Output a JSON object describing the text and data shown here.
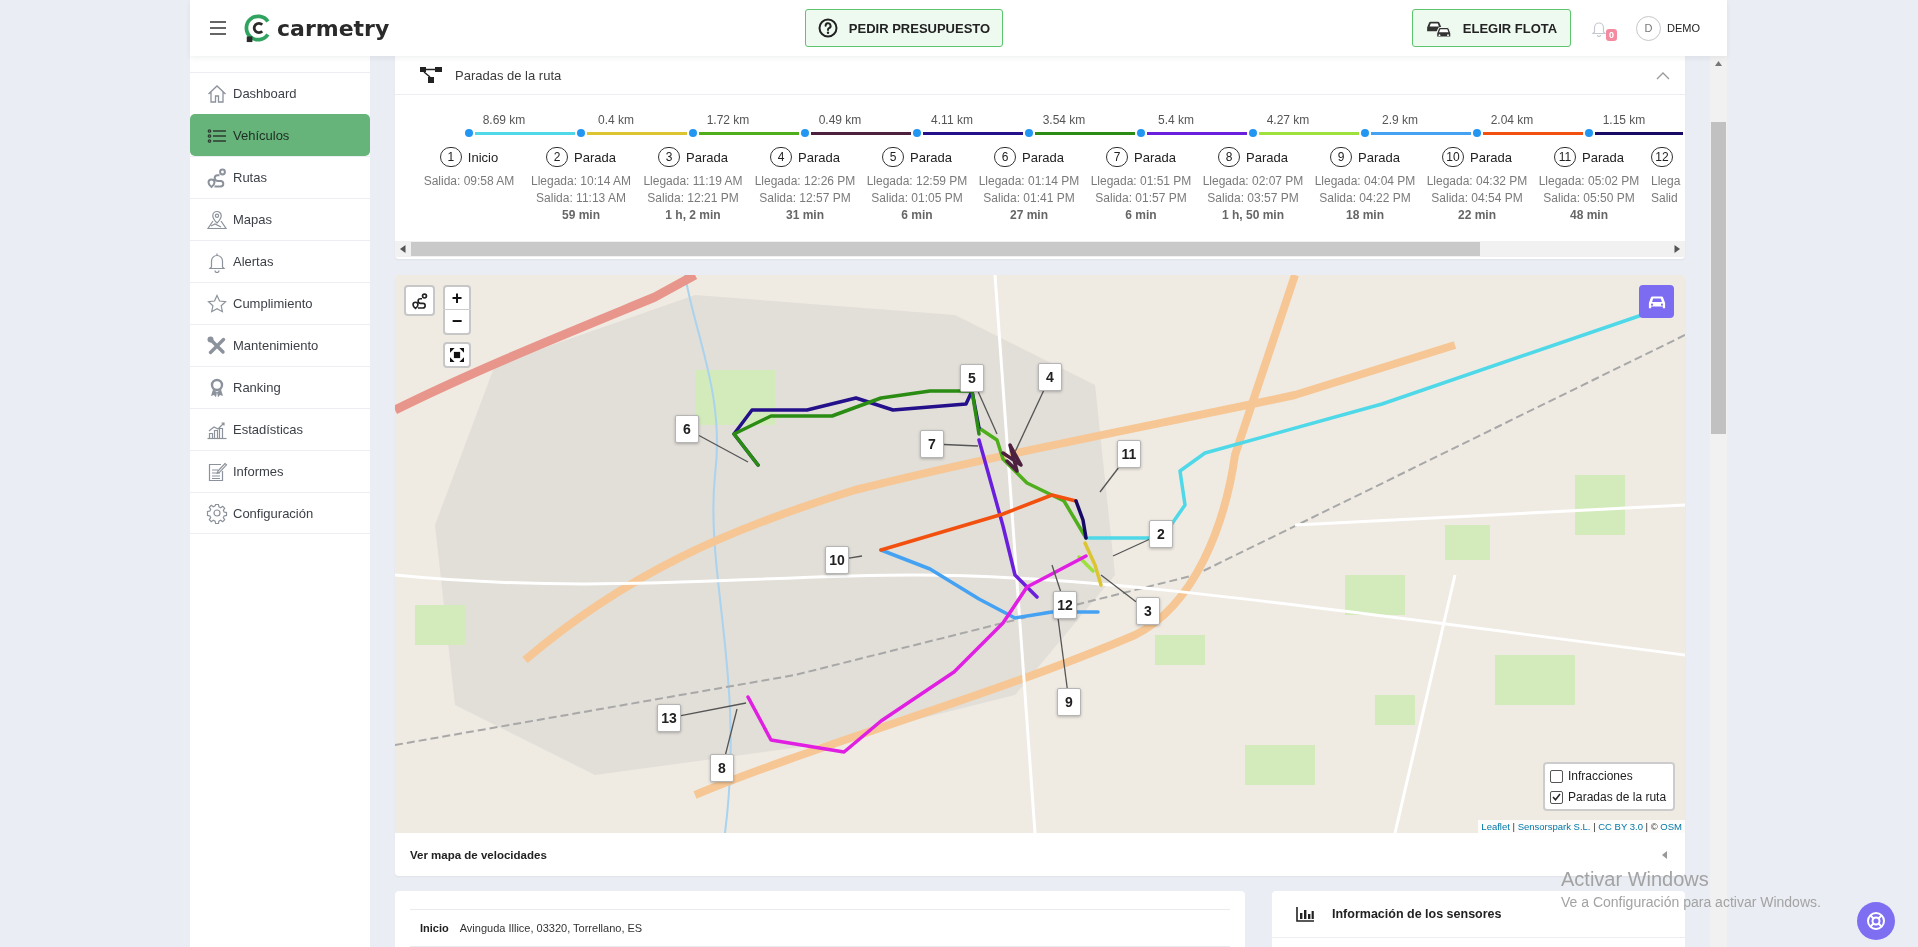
{
  "header": {
    "brand": "carmetry",
    "actions": [
      {
        "label": "PEDIR PRESUPUESTO",
        "kind": "quote"
      },
      {
        "label": "ELEGIR FLOTA",
        "kind": "fleet"
      }
    ],
    "notifications": {
      "count": "0"
    },
    "user": {
      "initial": "D",
      "name": "DEMO"
    }
  },
  "sidebar": {
    "items": [
      {
        "label": "Dashboard",
        "selected": false
      },
      {
        "label": "Vehículos",
        "selected": true
      },
      {
        "label": "Rutas",
        "selected": false
      },
      {
        "label": "Mapas",
        "selected": false
      },
      {
        "label": "Alertas",
        "selected": false
      },
      {
        "label": "Cumplimiento",
        "selected": false
      },
      {
        "label": "Mantenimiento",
        "selected": false
      },
      {
        "label": "Ranking",
        "selected": false
      },
      {
        "label": "Estadísticas",
        "selected": false
      },
      {
        "label": "Informes",
        "selected": false
      },
      {
        "label": "Configuración",
        "selected": false
      }
    ]
  },
  "route_stops": {
    "title": "Paradas de la ruta",
    "expanded": true,
    "segments": [
      {
        "distance": "8.69 km",
        "color": "#4fd8e8"
      },
      {
        "distance": "0.4 km",
        "color": "#dcc531"
      },
      {
        "distance": "1.72 km",
        "color": "#4fae1c"
      },
      {
        "distance": "0.49 km",
        "color": "#4e2040"
      },
      {
        "distance": "4.11 km",
        "color": "#24108a"
      },
      {
        "distance": "3.54 km",
        "color": "#2a8c12"
      },
      {
        "distance": "5.4 km",
        "color": "#6a1fdc"
      },
      {
        "distance": "4.27 km",
        "color": "#9ee03c"
      },
      {
        "distance": "2.9 km",
        "color": "#45a2f2"
      },
      {
        "distance": "2.04 km",
        "color": "#f2500f"
      },
      {
        "distance": "1.15 km",
        "color": "#170a66"
      }
    ],
    "stops": [
      {
        "number": "1",
        "name": "Inicio",
        "departure": "Salida: 09:58 AM"
      },
      {
        "number": "2",
        "name": "Parada",
        "arrival": "Llegada: 10:14 AM",
        "departure": "Salida: 11:13 AM",
        "duration": "59 min"
      },
      {
        "number": "3",
        "name": "Parada",
        "arrival": "Llegada: 11:19 AM",
        "departure": "Salida: 12:21 PM",
        "duration": "1 h, 2 min"
      },
      {
        "number": "4",
        "name": "Parada",
        "arrival": "Llegada: 12:26 PM",
        "departure": "Salida: 12:57 PM",
        "duration": "31 min"
      },
      {
        "number": "5",
        "name": "Parada",
        "arrival": "Llegada: 12:59 PM",
        "departure": "Salida: 01:05 PM",
        "duration": "6 min"
      },
      {
        "number": "6",
        "name": "Parada",
        "arrival": "Llegada: 01:14 PM",
        "departure": "Salida: 01:41 PM",
        "duration": "27 min"
      },
      {
        "number": "7",
        "name": "Parada",
        "arrival": "Llegada: 01:51 PM",
        "departure": "Salida: 01:57 PM",
        "duration": "6 min"
      },
      {
        "number": "8",
        "name": "Parada",
        "arrival": "Llegada: 02:07 PM",
        "departure": "Salida: 03:57 PM",
        "duration": "1 h, 50 min"
      },
      {
        "number": "9",
        "name": "Parada",
        "arrival": "Llegada: 04:04 PM",
        "departure": "Salida: 04:22 PM",
        "duration": "18 min"
      },
      {
        "number": "10",
        "name": "Parada",
        "arrival": "Llegada: 04:32 PM",
        "departure": "Salida: 04:54 PM",
        "duration": "22 min"
      },
      {
        "number": "11",
        "name": "Parada",
        "arrival": "Llegada: 05:02 PM",
        "departure": "Salida: 05:50 PM",
        "duration": "48 min"
      },
      {
        "number": "12",
        "arrival": "Llega",
        "departure": "Salid"
      }
    ]
  },
  "map": {
    "zoom_in": "+",
    "zoom_out": "−",
    "markers": [
      {
        "label": "5"
      },
      {
        "label": "4"
      },
      {
        "label": "6"
      },
      {
        "label": "7"
      },
      {
        "label": "11"
      },
      {
        "label": "2"
      },
      {
        "label": "10"
      },
      {
        "label": "12"
      },
      {
        "label": "3"
      },
      {
        "label": "9"
      },
      {
        "label": "13"
      },
      {
        "label": "8"
      }
    ],
    "legend": [
      {
        "label": "Infracciones",
        "checked": false
      },
      {
        "label": "Paradas de la ruta",
        "checked": true
      }
    ],
    "attribution": [
      {
        "text": "Leaflet",
        "kind": "link"
      },
      {
        "text": "|",
        "kind": "text"
      },
      {
        "text": "Sensorspark S.L.",
        "kind": "link"
      },
      {
        "text": "|",
        "kind": "text"
      },
      {
        "text": "CC BY 3.0",
        "kind": "link"
      },
      {
        "text": "|",
        "kind": "text"
      },
      {
        "text": "©",
        "kind": "text"
      },
      {
        "text": "OSM",
        "kind": "link"
      }
    ],
    "footer_link": "Ver mapa de velocidades"
  },
  "summary": {
    "rows": [
      {
        "label": "Inicio",
        "value": "Avinguda Illice, 03320, Torrellano, ES"
      }
    ]
  },
  "sensors": {
    "title": "Información de los sensores"
  },
  "windows_watermark": {
    "title": "Activar Windows",
    "text": "Ve a Configuración para activar Windows."
  }
}
